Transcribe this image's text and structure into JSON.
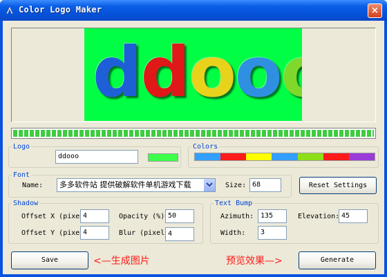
{
  "window": {
    "title": "Color Logo Maker",
    "close_glyph": "×"
  },
  "preview": {
    "background": "#00ff44",
    "letters": [
      {
        "char": "d",
        "color": "#1e5fd8"
      },
      {
        "char": "d",
        "color": "#e01818"
      },
      {
        "char": "o",
        "color": "#e8d21c"
      },
      {
        "char": "o",
        "color": "#2f8fe0"
      },
      {
        "char": "o",
        "color": "#7fd82a"
      }
    ]
  },
  "progress": {
    "percent": 100,
    "color": "#3fcc3f"
  },
  "logo_group": {
    "legend": "Logo",
    "text_value": "ddooo",
    "swatch_color": "#3dff4a"
  },
  "colors_group": {
    "legend": "Colors",
    "swatches": [
      "#33a0ff",
      "#ff1a1a",
      "#ffff00",
      "#33a0ff",
      "#8ddf1a",
      "#ff1a1a",
      "#9a3cd8"
    ]
  },
  "font_group": {
    "legend": "Font",
    "name_label": "Name:",
    "name_value": "多多软件站 提供破解软件单机游戏下载",
    "size_label": "Size:",
    "size_value": "68"
  },
  "reset_button": {
    "label": "Reset Settings"
  },
  "shadow_group": {
    "legend": "Shadow",
    "offset_x_label": "Offset X (pixe",
    "offset_x_value": "4",
    "offset_y_label": "Offset Y (pixe",
    "offset_y_value": "4",
    "opacity_label": "Opacity (%)",
    "opacity_value": "50",
    "blur_label": "Blur (pixel",
    "blur_value": "4"
  },
  "bump_group": {
    "legend": "Text Bump",
    "azimuth_label": "Azimuth:",
    "azimuth_value": "135",
    "elevation_label": "Elevation:",
    "elevation_value": "45",
    "width_label": "Width:",
    "width_value": "3"
  },
  "save_button": {
    "label": "Save"
  },
  "generate_button": {
    "label": "Generate"
  },
  "notes": {
    "save_note": "<—生成图片",
    "generate_note": "预览效果—>"
  }
}
